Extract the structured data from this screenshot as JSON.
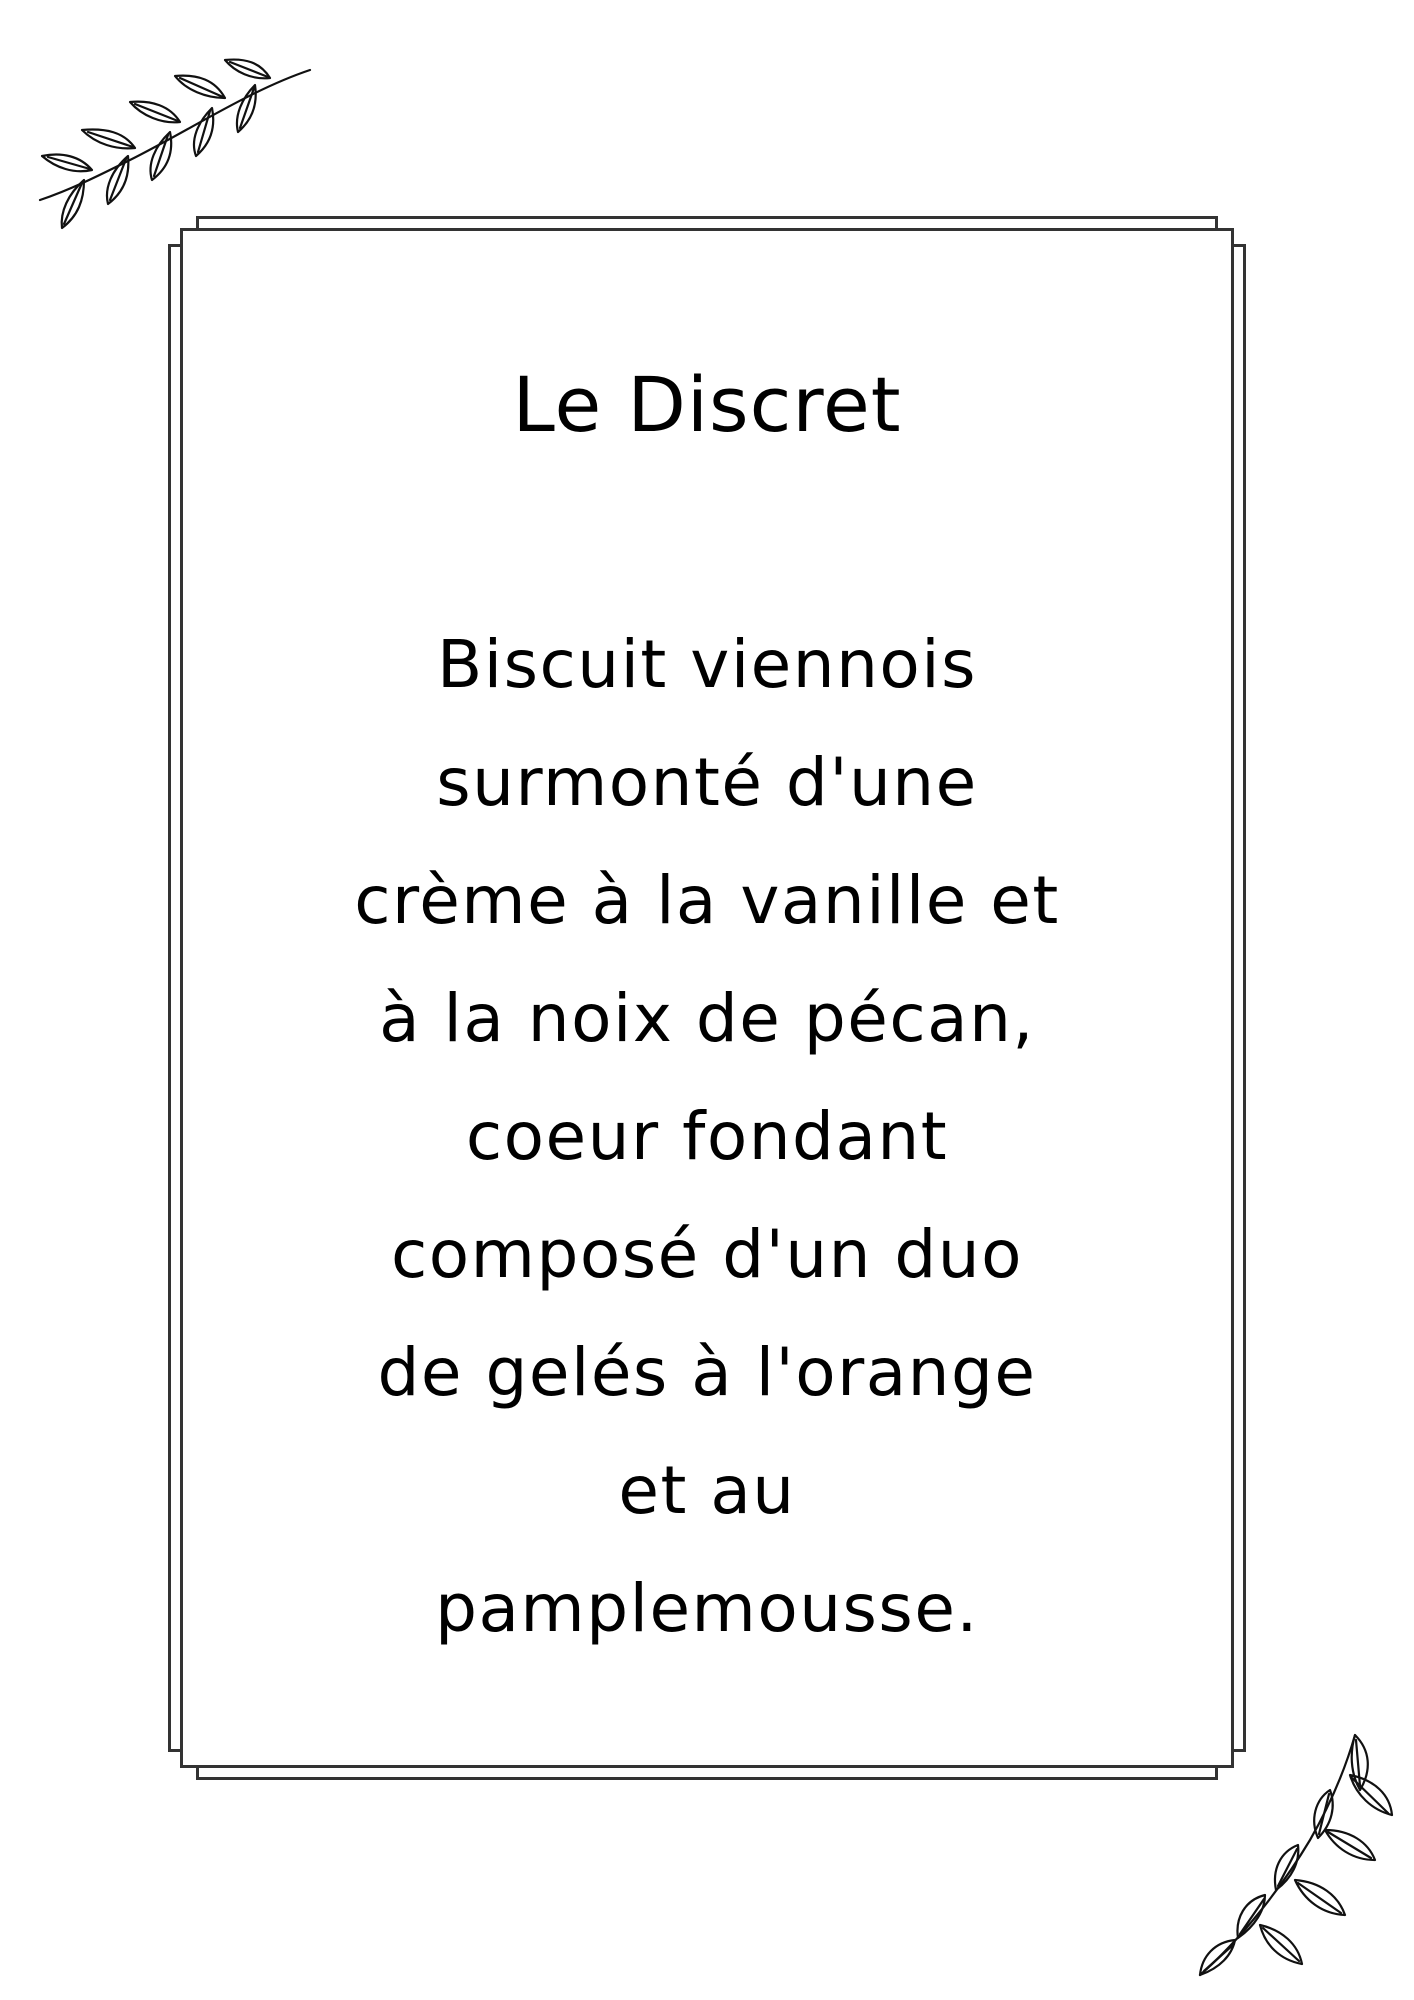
{
  "card": {
    "title": "Le Discret",
    "description_lines": [
      "Biscuit viennois",
      "surmonté d'une",
      "crème à la vanille et",
      "à la noix de pécan,",
      "coeur fondant",
      "composé d'un duo",
      "de gelés à l'orange",
      "et au",
      "pamplemousse."
    ]
  },
  "decorations": {
    "top_left": "leaf-sprig-icon",
    "bottom_right": "leaf-sprig-icon"
  },
  "colors": {
    "background": "#ffffff",
    "frame": "#333333",
    "text": "#000000"
  }
}
